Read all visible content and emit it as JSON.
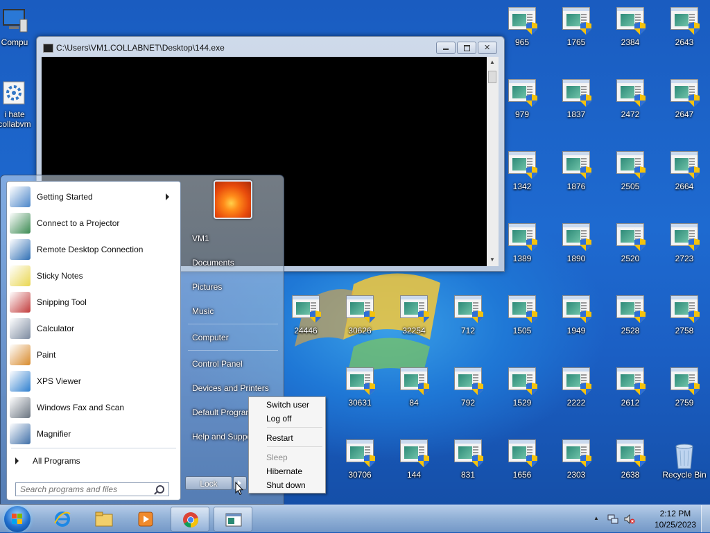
{
  "desktop": {
    "left_icons": [
      {
        "label": "Compu",
        "icon": "computer-icon"
      },
      {
        "label": "i hate\ncollabvm",
        "icon": "gear-icon"
      }
    ],
    "exe_icons": [
      {
        "label": "965"
      },
      {
        "label": "1765"
      },
      {
        "label": "2384"
      },
      {
        "label": "2643"
      },
      {
        "label": "979"
      },
      {
        "label": "1837"
      },
      {
        "label": "2472"
      },
      {
        "label": "2647"
      },
      {
        "label": "1342"
      },
      {
        "label": "1876"
      },
      {
        "label": "2505"
      },
      {
        "label": "2664"
      },
      {
        "label": "1389"
      },
      {
        "label": "1890"
      },
      {
        "label": "2520"
      },
      {
        "label": "2723"
      },
      {
        "label": "24446"
      },
      {
        "label": "30626"
      },
      {
        "label": "32254"
      },
      {
        "label": "712"
      },
      {
        "label": "1505"
      },
      {
        "label": "1949"
      },
      {
        "label": "2528"
      },
      {
        "label": "2758"
      },
      {
        "label": "30631"
      },
      {
        "label": "84"
      },
      {
        "label": "792"
      },
      {
        "label": "1529"
      },
      {
        "label": "2222"
      },
      {
        "label": "2612"
      },
      {
        "label": "2759"
      },
      {
        "label": "30706"
      },
      {
        "label": "144"
      },
      {
        "label": "831"
      },
      {
        "label": "1656"
      },
      {
        "label": "2303"
      },
      {
        "label": "2638"
      }
    ],
    "recycle_bin": {
      "label": "Recycle Bin",
      "icon": "recycle-bin-icon"
    }
  },
  "console_window": {
    "title": "C:\\Users\\VM1.COLLABNET\\Desktop\\144.exe",
    "buttons": [
      "minimize",
      "restore",
      "close"
    ]
  },
  "start_menu": {
    "programs": [
      {
        "label": "Getting Started",
        "icon": "getting-started-icon",
        "submenu": true
      },
      {
        "label": "Connect to a Projector",
        "icon": "projector-icon"
      },
      {
        "label": "Remote Desktop Connection",
        "icon": "remote-desktop-icon"
      },
      {
        "label": "Sticky Notes",
        "icon": "sticky-notes-icon"
      },
      {
        "label": "Snipping Tool",
        "icon": "scissors-icon"
      },
      {
        "label": "Calculator",
        "icon": "calculator-icon"
      },
      {
        "label": "Paint",
        "icon": "paint-palette-icon"
      },
      {
        "label": "XPS Viewer",
        "icon": "xps-viewer-icon"
      },
      {
        "label": "Windows Fax and Scan",
        "icon": "fax-icon"
      },
      {
        "label": "Magnifier",
        "icon": "magnifier-icon"
      }
    ],
    "all_programs": "All Programs",
    "search_placeholder": "Search programs and files",
    "right_links": [
      "VM1",
      "Documents",
      "Pictures",
      "Music",
      "Computer",
      "Control Panel",
      "Devices and Printers",
      "Default Programs",
      "Help and Support"
    ],
    "lock_label": "Lock"
  },
  "power_menu": {
    "items": [
      {
        "label": "Switch user",
        "enabled": true
      },
      {
        "label": "Log off",
        "enabled": true
      },
      {
        "label": "Restart",
        "enabled": true
      },
      {
        "label": "Sleep",
        "enabled": false
      },
      {
        "label": "Hibernate",
        "enabled": true
      },
      {
        "label": "Shut down",
        "enabled": true
      }
    ]
  },
  "taskbar": {
    "pinned": [
      {
        "name": "internet-explorer-icon"
      },
      {
        "name": "file-explorer-icon"
      },
      {
        "name": "media-player-icon"
      },
      {
        "name": "chrome-icon",
        "active": true
      },
      {
        "name": "console-app-icon",
        "active": true
      }
    ],
    "time": "2:12 PM",
    "date": "10/25/2023"
  }
}
